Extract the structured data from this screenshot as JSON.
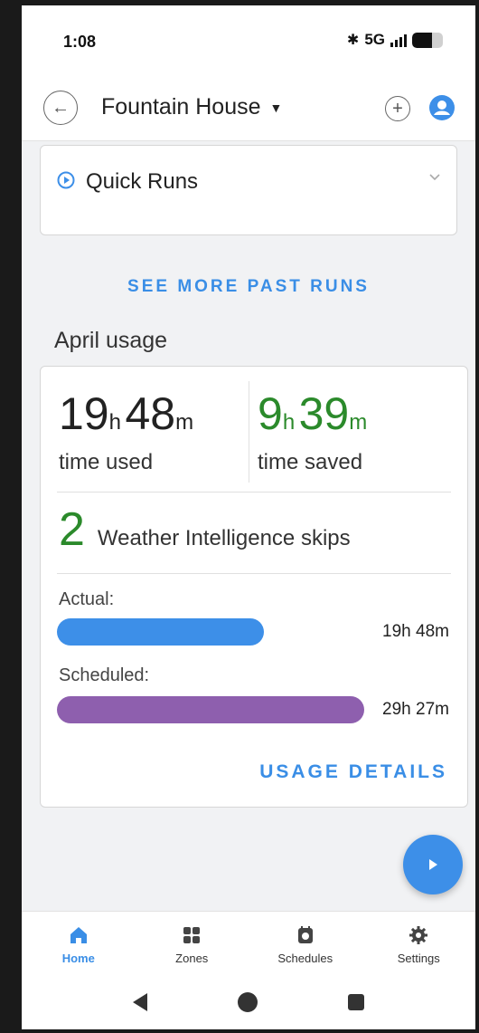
{
  "status_bar": {
    "time": "1:08",
    "network": "5G",
    "bluetooth_icon": "bluetooth-icon",
    "signal_icon": "signal-icon",
    "battery_icon": "battery-icon"
  },
  "header": {
    "title": "Fountain House",
    "back_icon": "back-arrow-icon",
    "add_icon": "plus-circle-icon",
    "account_icon": "account-circle-icon"
  },
  "quick_runs": {
    "label": "Quick Runs",
    "icon": "play-circle-icon",
    "expand_icon": "chevron-down-icon"
  },
  "see_more_label": "SEE MORE PAST RUNS",
  "usage": {
    "title": "April usage",
    "time_used": {
      "hours": "19",
      "hours_unit": "h",
      "minutes": "48",
      "minutes_unit": "m",
      "label": "time used"
    },
    "time_saved": {
      "hours": "9",
      "hours_unit": "h",
      "minutes": "39",
      "minutes_unit": "m",
      "label": "time saved"
    },
    "skips": {
      "count": "2",
      "label": "Weather Intelligence skips"
    },
    "actual": {
      "label": "Actual:",
      "value": "19h 48m",
      "fraction": 0.673,
      "color": "#3d8fe8"
    },
    "scheduled": {
      "label": "Scheduled:",
      "value": "29h 27m",
      "fraction": 1.0,
      "color": "#8e5fae"
    },
    "details_label": "USAGE DETAILS"
  },
  "fab_icon": "play-icon",
  "bottom_nav": {
    "items": [
      {
        "label": "Home",
        "icon": "home-icon",
        "active": true
      },
      {
        "label": "Zones",
        "icon": "zones-icon",
        "active": false
      },
      {
        "label": "Schedules",
        "icon": "schedules-icon",
        "active": false
      },
      {
        "label": "Settings",
        "icon": "gear-icon",
        "active": false
      }
    ]
  },
  "colors": {
    "accent": "#3a8ee6",
    "saved_green": "#2b8a2b",
    "actual_bar": "#3d8fe8",
    "scheduled_bar": "#8e5fae"
  }
}
